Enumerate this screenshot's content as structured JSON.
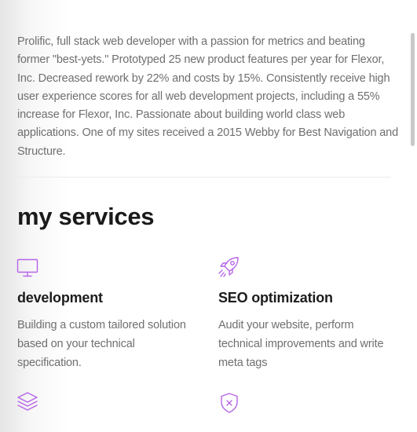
{
  "about": {
    "text": "Prolific, full stack web developer with a passion for metrics and beating former \"best-yets.\" Prototyped 25 new product features per year for Flexor, Inc. Decreased rework by 22% and costs by 15%. Consistently receive high user experience scores for all web development projects, including a 55% increase for Flexor, Inc. Passionate about building world class web applications. One of my sites received a 2015 Webby for Best Navigation and Structure."
  },
  "services": {
    "heading": "my services",
    "accent_color": "#b564e8",
    "items": [
      {
        "icon": "monitor-icon",
        "title": "development",
        "description": "Building a custom tailored solution based on your technical specification."
      },
      {
        "icon": "rocket-icon",
        "title": "SEO optimization",
        "description": "Audit your website, perform technical improvements and write meta tags"
      },
      {
        "icon": "layers-icon"
      },
      {
        "icon": "shield-icon"
      }
    ]
  }
}
